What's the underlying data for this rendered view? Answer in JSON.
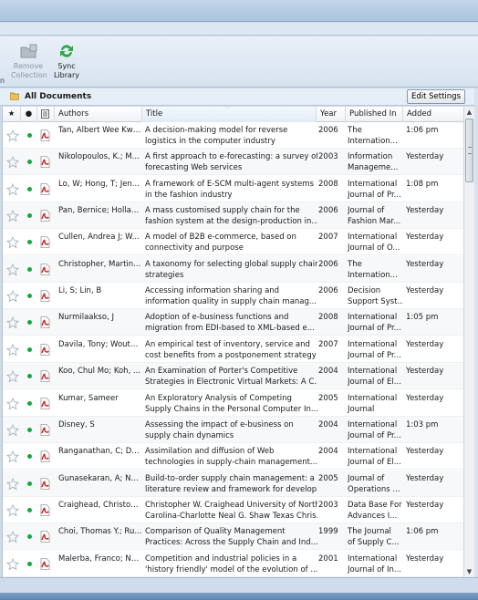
{
  "toolbar": {
    "edge_label": "n",
    "remove_collection": {
      "line1": "Remove",
      "line2": "Collection"
    },
    "sync_library": {
      "line1": "Sync",
      "line2": "Library"
    }
  },
  "doc_list": {
    "title": "All Documents",
    "edit_settings_label": "Edit Settings"
  },
  "columns": {
    "star": "★",
    "read": "●",
    "file": "",
    "authors": "Authors",
    "title": "Title",
    "title_sort_arrow": "^",
    "year": "Year",
    "published_in": "Published In",
    "added": "Added"
  },
  "colors": {
    "accent": "#1aa63f",
    "pdf_red": "#c8231e",
    "ribbon": "#dfe8f3"
  },
  "documents": [
    {
      "authors": "Tan, Albert Wee Kwa...",
      "title1": "A decision-making model for reverse",
      "title2": "logistics in the computer industry",
      "year": "2006",
      "pub1": "The",
      "pub2": "Internation...",
      "added": "1:06 pm"
    },
    {
      "authors": "Nikolopoulos, K.; M...",
      "title1": "A first approach to e-forecasting: a survey of",
      "title2": "forecasting Web services",
      "year": "2003",
      "pub1": "Information",
      "pub2": "Manageme...",
      "added": "Yesterday"
    },
    {
      "authors": "Lo, W; Hong, T; Jen...",
      "title1": "A framework of E-SCM multi-agent systems",
      "title2": "in the fashion industry",
      "year": "2008",
      "pub1": "International",
      "pub2": "Journal of Pr...",
      "added": "1:08 pm"
    },
    {
      "authors": "Pan, Bernice; Hollan...",
      "title1": "A mass customised supply chain for the",
      "title2": "fashion system at the design-production in...",
      "year": "2006",
      "pub1": "Journal of",
      "pub2": "Fashion Mar...",
      "added": "Yesterday"
    },
    {
      "authors": "Cullen, Andrea J; W...",
      "title1": "A model of B2B e-commerce, based on",
      "title2": "connectivity and purpose",
      "year": "2007",
      "pub1": "International",
      "pub2": "Journal of O...",
      "added": "Yesterday"
    },
    {
      "authors": "Christopher, Martin...",
      "title1": "A taxonomy for selecting global supply chain",
      "title2": "strategies",
      "year": "2006",
      "pub1": "The",
      "pub2": "Internation...",
      "added": "Yesterday"
    },
    {
      "authors": "Li, S; Lin, B",
      "title1": "Accessing information sharing and",
      "title2": "information quality in supply chain manag...",
      "year": "2006",
      "pub1": "Decision",
      "pub2": "Support Syst...",
      "added": "Yesterday"
    },
    {
      "authors": "Nurmilaakso, J",
      "title1": "Adoption of e-business functions and",
      "title2": "migration from EDI-based to XML-based e...",
      "year": "2008",
      "pub1": "International",
      "pub2": "Journal of Pr...",
      "added": "1:05 pm"
    },
    {
      "authors": "Davila, Tony; Woute...",
      "title1": "An empirical test of inventory, service and",
      "title2": "cost benefits from a postponement strategy",
      "year": "2007",
      "pub1": "International",
      "pub2": "Journal of Pr...",
      "added": "Yesterday"
    },
    {
      "authors": "Koo, Chul Mo; Koh, ...",
      "title1": "An Examination of Porter's Competitive",
      "title2": "Strategies in Electronic Virtual Markets: A C...",
      "year": "2004",
      "pub1": "International",
      "pub2": "Journal of El...",
      "added": "Yesterday"
    },
    {
      "authors": "Kumar, Sameer",
      "title1": "An Exploratory Analysis of Competing",
      "title2": "Supply Chains in the Personal Computer In...",
      "year": "2005",
      "pub1": "International",
      "pub2": "Journal",
      "added": "Yesterday"
    },
    {
      "authors": "Disney, S",
      "title1": "Assessing the impact of e-business on",
      "title2": "supply chain dynamics",
      "year": "2004",
      "pub1": "International",
      "pub2": "Journal of Pr...",
      "added": "1:03 pm"
    },
    {
      "authors": "Ranganathan, C; Dh...",
      "title1": "Assimilation and diffusion of Web",
      "title2": "technologies in supply-chain management...",
      "year": "2004",
      "pub1": "International",
      "pub2": "Journal of El...",
      "added": "Yesterday"
    },
    {
      "authors": "Gunasekaran, A; Ng...",
      "title1": "Build-to-order supply chain management: a",
      "title2": "literature review and framework for develop...",
      "year": "2005",
      "pub1": "Journal of",
      "pub2": "Operations ...",
      "added": "Yesterday"
    },
    {
      "authors": "Craighead, Christop...",
      "title1": "Christopher W. Craighead University of North",
      "title2": "Carolina-Charlotte Neal G. Shaw Texas Chris...",
      "year": "2003",
      "pub1": "Data Base For",
      "pub2": "Advances I...",
      "added": "Yesterday"
    },
    {
      "authors": "Choi, Thomas Y.; Ru...",
      "title1": "Comparison of Quality Management",
      "title2": "Practices: Across the Supply Chain and Ind...",
      "year": "1999",
      "pub1": "The Journal",
      "pub2": "of Supply C...",
      "added": "1:06 pm"
    },
    {
      "authors": "Malerba, Franco; Ne...",
      "title1": "Competition and industrial policies in a",
      "title2": "'history friendly' model of the evolution of ...",
      "year": "2001",
      "pub1": "International",
      "pub2": "Journal of In...",
      "added": "Yesterday"
    }
  ]
}
